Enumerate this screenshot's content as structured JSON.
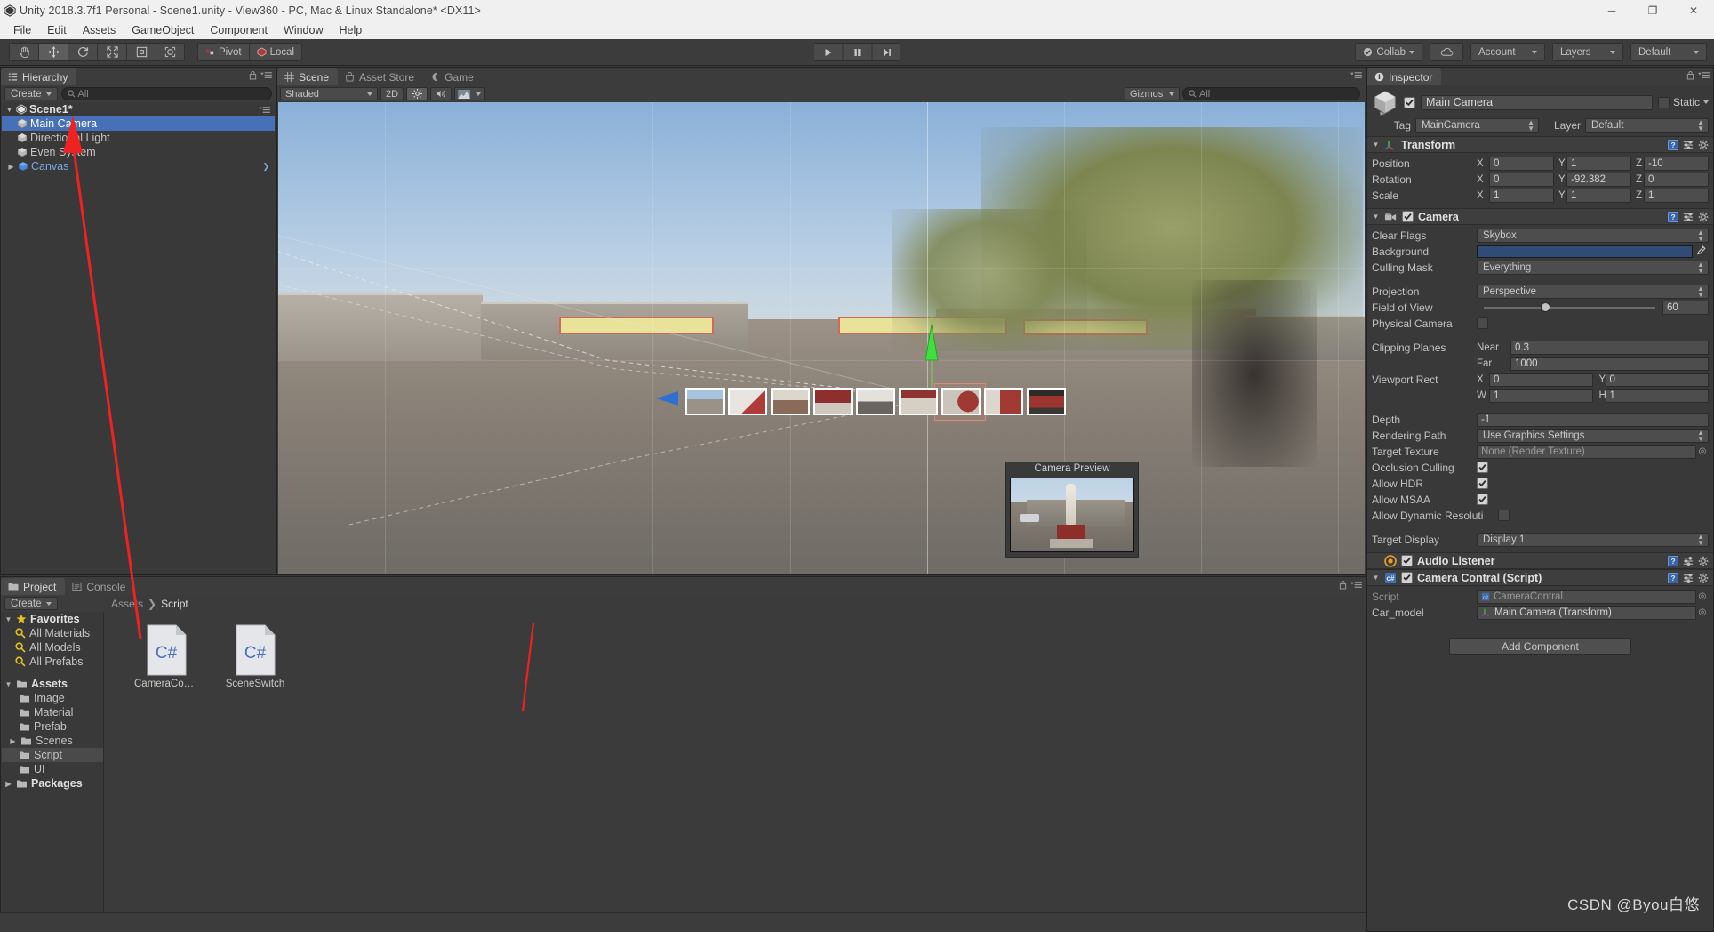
{
  "window": {
    "title": "Unity 2018.3.7f1 Personal - Scene1.unity - View360 - PC, Mac & Linux Standalone* <DX11>",
    "minimize": "─",
    "maximize": "❐",
    "close": "✕"
  },
  "menubar": {
    "items": [
      "File",
      "Edit",
      "Assets",
      "GameObject",
      "Component",
      "Window",
      "Help"
    ]
  },
  "toolbar": {
    "tools": [
      {
        "name": "hand-tool",
        "glyph": "✋"
      },
      {
        "name": "move-tool",
        "glyph": "✥"
      },
      {
        "name": "rotate-tool",
        "glyph": "↻"
      },
      {
        "name": "scale-tool",
        "glyph": "⤡"
      },
      {
        "name": "rect-tool",
        "glyph": "▣"
      },
      {
        "name": "transform-tool",
        "glyph": "◎"
      }
    ],
    "pivot": "Pivot",
    "local": "Local",
    "play": "▶",
    "pause": "‖",
    "step": "▶|",
    "collab": "Collab",
    "cloud": "cloud-icon",
    "account": "Account",
    "layers": "Layers",
    "layout": "Default"
  },
  "hierarchy": {
    "tab": "Hierarchy",
    "create": "Create",
    "search_placeholder": "All",
    "items": [
      {
        "label": "Scene1*",
        "depth": 0,
        "kind": "scene",
        "expanded": true,
        "selected": false
      },
      {
        "label": "Main Camera",
        "depth": 1,
        "kind": "gameobject",
        "selected": true
      },
      {
        "label": "Directional Light",
        "depth": 1,
        "kind": "gameobject",
        "selected": false
      },
      {
        "label": "Even System",
        "depth": 1,
        "kind": "gameobject",
        "selected": false
      },
      {
        "label": "Canvas",
        "depth": 1,
        "kind": "prefab",
        "selected": false,
        "expandable": true
      }
    ]
  },
  "scene_view": {
    "tabs": [
      {
        "label": "Scene",
        "icon": "grid-icon",
        "active": true
      },
      {
        "label": "Asset Store",
        "icon": "store-icon",
        "active": false
      },
      {
        "label": "Game",
        "icon": "gamepad-icon",
        "active": false
      }
    ],
    "draw_mode": "Shaded",
    "two_d": "2D",
    "lighting": "light-icon",
    "audio": "audio-icon",
    "fx": "fx-icon",
    "gizmos": "Gizmos",
    "search_placeholder": "All",
    "camera_preview_title": "Camera Preview",
    "thumbnail_count": 9
  },
  "inspector": {
    "tab": "Inspector",
    "object_name": "Main Camera",
    "object_enabled": true,
    "static_label": "Static",
    "tag_label": "Tag",
    "tag_value": "MainCamera",
    "layer_label": "Layer",
    "layer_value": "Default",
    "components": [
      {
        "name": "Transform",
        "icon": "transform-icon",
        "has_checkbox": false,
        "rows": [
          {
            "type": "vec3",
            "label": "Position",
            "x": "0",
            "y": "1",
            "z": "-10"
          },
          {
            "type": "vec3",
            "label": "Rotation",
            "x": "0",
            "y": "-92.382",
            "z": "0"
          },
          {
            "type": "vec3",
            "label": "Scale",
            "x": "1",
            "y": "1",
            "z": "1"
          }
        ]
      },
      {
        "name": "Camera",
        "icon": "camera-icon",
        "has_checkbox": true,
        "checked": true,
        "rows": [
          {
            "type": "dropdown",
            "label": "Clear Flags",
            "value": "Skybox"
          },
          {
            "type": "color",
            "label": "Background",
            "value": "#2f4b76"
          },
          {
            "type": "dropdown",
            "label": "Culling Mask",
            "value": "Everything"
          },
          {
            "type": "spacer"
          },
          {
            "type": "dropdown",
            "label": "Projection",
            "value": "Perspective"
          },
          {
            "type": "slider",
            "label": "Field of View",
            "value": "60",
            "fraction": 0.33
          },
          {
            "type": "checkbox",
            "label": "Physical Camera",
            "checked": false
          },
          {
            "type": "spacer"
          },
          {
            "type": "pair",
            "label": "Clipping Planes",
            "k1": "Near",
            "v1": "0.3"
          },
          {
            "type": "pair",
            "label": "",
            "k1": "Far",
            "v1": "1000"
          },
          {
            "type": "rect",
            "label": "Viewport Rect",
            "x_lbl": "X",
            "x": "0",
            "y_lbl": "Y",
            "y": "0",
            "w_lbl": "W",
            "w": "1",
            "h_lbl": "H",
            "h": "1"
          },
          {
            "type": "spacer"
          },
          {
            "type": "text",
            "label": "Depth",
            "value": "-1"
          },
          {
            "type": "dropdown",
            "label": "Rendering Path",
            "value": "Use Graphics Settings"
          },
          {
            "type": "object",
            "label": "Target Texture",
            "value": "None (Render Texture)"
          },
          {
            "type": "checkbox",
            "label": "Occlusion Culling",
            "checked": true
          },
          {
            "type": "checkbox",
            "label": "Allow HDR",
            "checked": true
          },
          {
            "type": "checkbox",
            "label": "Allow MSAA",
            "checked": true
          },
          {
            "type": "checkbox",
            "label": "Allow Dynamic Resoluti",
            "checked": false
          },
          {
            "type": "spacer"
          },
          {
            "type": "dropdown",
            "label": "Target Display",
            "value": "Display 1"
          }
        ]
      },
      {
        "name": "Audio Listener",
        "icon": "audio-listener-icon",
        "has_checkbox": true,
        "checked": true,
        "rows": []
      },
      {
        "name": "Camera Contral (Script)",
        "icon": "csharp-icon",
        "has_checkbox": true,
        "checked": true,
        "rows": [
          {
            "type": "object",
            "label": "Script",
            "value": "CameraContral",
            "dim": true
          },
          {
            "type": "object",
            "label": "Car_model",
            "value": "Main Camera (Transform)"
          }
        ]
      }
    ],
    "add_component": "Add Component"
  },
  "project": {
    "tabs": [
      {
        "label": "Project",
        "icon": "folder-icon",
        "active": true
      },
      {
        "label": "Console",
        "icon": "console-icon",
        "active": false
      }
    ],
    "create": "Create",
    "search_placeholder": "",
    "breadcrumb": [
      "Assets",
      "Script"
    ],
    "tree": [
      {
        "label": "Favorites",
        "depth": 0,
        "kind": "favorites",
        "expanded": true
      },
      {
        "label": "All Materials",
        "depth": 1,
        "kind": "search"
      },
      {
        "label": "All Models",
        "depth": 1,
        "kind": "search"
      },
      {
        "label": "All Prefabs",
        "depth": 1,
        "kind": "search"
      },
      {
        "label": "Assets",
        "depth": 0,
        "kind": "folder",
        "expanded": true
      },
      {
        "label": "Image",
        "depth": 1,
        "kind": "folder"
      },
      {
        "label": "Material",
        "depth": 1,
        "kind": "folder"
      },
      {
        "label": "Prefab",
        "depth": 1,
        "kind": "folder"
      },
      {
        "label": "Scenes",
        "depth": 1,
        "kind": "folder",
        "expandable": true
      },
      {
        "label": "Script",
        "depth": 1,
        "kind": "folder",
        "selected": true
      },
      {
        "label": "UI",
        "depth": 1,
        "kind": "folder"
      },
      {
        "label": "Packages",
        "depth": 0,
        "kind": "folder",
        "expandable": true
      }
    ],
    "assets": [
      {
        "name": "CameraCon…",
        "type": "C#"
      },
      {
        "name": "SceneSwitch",
        "type": "C#"
      }
    ]
  },
  "watermark": "CSDN @Byou白悠"
}
